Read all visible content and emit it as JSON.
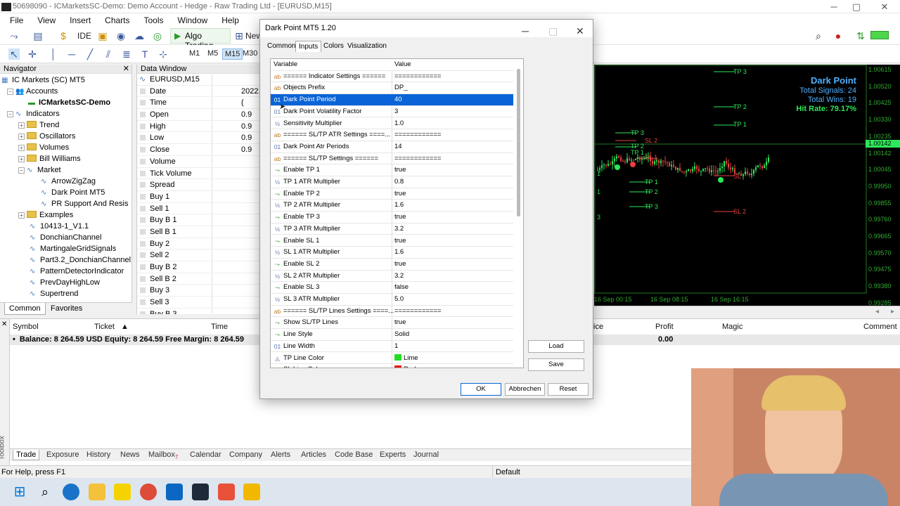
{
  "window": {
    "title": "50698090 - ICMarketsSC-Demo: Demo Account - Hedge - Raw Trading Ltd - [EURUSD,M15]"
  },
  "menu": [
    "File",
    "View",
    "Insert",
    "Charts",
    "Tools",
    "Window",
    "Help"
  ],
  "toolbar": {
    "ide": "IDE",
    "algo_trading": "Algo Trading",
    "new_order": "New",
    "timeframes": [
      "M1",
      "M5",
      "M15",
      "M30"
    ],
    "active_timeframe": "M15"
  },
  "navigator": {
    "title": "Navigator",
    "root": "IC Markets (SC) MT5",
    "accounts": "Accounts",
    "account_name": "ICMarketsSC-Demo",
    "indicators": "Indicators",
    "folders": [
      "Trend",
      "Oscillators",
      "Volumes",
      "Bill Williams"
    ],
    "market": "Market",
    "market_items": [
      "ArrowZigZag",
      "Dark Point MT5",
      "PR Support And Resis"
    ],
    "examples": "Examples",
    "items": [
      "10413-1_V1.1",
      "DonchianChannel",
      "MartingaleGridSignals",
      "Part3.2_DonchianChannel",
      "PatternDetectorIndicator",
      "PrevDayHighLow",
      "Supertrend"
    ],
    "tabs": [
      "Common",
      "Favorites"
    ]
  },
  "data_window": {
    "title": "Data Window",
    "symbol": "EURUSD,M15",
    "rows": [
      {
        "label": "Date",
        "value": "2022."
      },
      {
        "label": "Time",
        "value": "("
      },
      {
        "label": "Open",
        "value": "0.9"
      },
      {
        "label": "High",
        "value": "0.9"
      },
      {
        "label": "Low",
        "value": "0.9"
      },
      {
        "label": "Close",
        "value": "0.9"
      },
      {
        "label": "Volume",
        "value": ""
      },
      {
        "label": "Tick Volume",
        "value": ""
      },
      {
        "label": "Spread",
        "value": ""
      },
      {
        "label": "Buy 1",
        "value": ""
      },
      {
        "label": "Sell 1",
        "value": ""
      },
      {
        "label": "Buy B 1",
        "value": ""
      },
      {
        "label": "Sell B 1",
        "value": ""
      },
      {
        "label": "Buy 2",
        "value": ""
      },
      {
        "label": "Sell 2",
        "value": ""
      },
      {
        "label": "Buy B 2",
        "value": ""
      },
      {
        "label": "Sell B 2",
        "value": ""
      },
      {
        "label": "Buy 3",
        "value": ""
      },
      {
        "label": "Sell 3",
        "value": ""
      },
      {
        "label": "Buy B 3",
        "value": ""
      }
    ]
  },
  "chart": {
    "panel_title": "Dark Point",
    "total_signals": "Total Signals: 24",
    "total_wins": "Total Wins: 19",
    "hit_rate": "Hit Rate: 79.17%",
    "prices": [
      "1.00615",
      "1.00520",
      "1.00425",
      "1.00330",
      "1.00235",
      "1.00142",
      "1.00045",
      "0.99950",
      "0.99855",
      "0.99760",
      "0.99665",
      "0.99570",
      "0.99475",
      "0.99380",
      "0.99285"
    ],
    "current_price": "1.00142",
    "dates": [
      "16 Sep 00:15",
      "16 Sep 08:15",
      "16 Sep 16:15"
    ],
    "labels_tp": [
      "TP 3",
      "TP 2",
      "TP 1",
      "TP 3",
      "TP 2",
      "TP 1",
      "TP 1",
      "TP 2",
      "TP 3"
    ],
    "labels_sl": [
      "SL 2",
      "SL 1",
      "SL",
      "SL 2"
    ],
    "left_digits": [
      "1",
      "1",
      "3"
    ]
  },
  "toolbox": {
    "columns": [
      "Symbol",
      "Ticket",
      "Time",
      "ice",
      "Profit",
      "Magic",
      "Comment"
    ],
    "balance": "Balance: 8 264.59 USD  Equity: 8 264.59  Free Margin: 8 264.59",
    "profit_total": "0.00",
    "side_label": "Toolbox",
    "tabs": [
      "Trade",
      "Exposure",
      "History",
      "News",
      "Mailbox",
      "Calendar",
      "Company",
      "Alerts",
      "Articles",
      "Code Base",
      "Experts",
      "Journal"
    ],
    "mailbox_badge": "7"
  },
  "status": {
    "help": "For Help, press F1",
    "profile": "Default"
  },
  "dialog": {
    "title": "Dark Point MT5 1.20",
    "tabs": [
      "Common",
      "Inputs",
      "Colors",
      "Visualization"
    ],
    "active_tab": "Inputs",
    "header": {
      "variable": "Variable",
      "value": "Value"
    },
    "rows": [
      {
        "type": "ab",
        "name": "====== Indicator Settings ======",
        "value": "============"
      },
      {
        "type": "ab",
        "name": "Objects Prefix",
        "value": "DP_"
      },
      {
        "type": "01",
        "name": "Dark Point Period",
        "value": "40",
        "selected": true
      },
      {
        "type": "01",
        "name": "Dark Point Volatility Factor",
        "value": "3"
      },
      {
        "type": "½",
        "name": "Sensitivity Multiplier",
        "value": "1.0"
      },
      {
        "type": "ab",
        "name": "====== SL/TP ATR Settings ====...",
        "value": "============"
      },
      {
        "type": "01",
        "name": "Dark Point Atr Periods",
        "value": "14"
      },
      {
        "type": "ab",
        "name": "====== SL/TP Settings ======",
        "value": "============"
      },
      {
        "type": "bool",
        "name": "Enable TP 1",
        "value": "true"
      },
      {
        "type": "½",
        "name": "TP 1 ATR Multiplier",
        "value": "0.8"
      },
      {
        "type": "bool",
        "name": "Enable TP 2",
        "value": "true"
      },
      {
        "type": "½",
        "name": "TP 2 ATR Multiplier",
        "value": "1.6"
      },
      {
        "type": "bool",
        "name": "Enable TP 3",
        "value": "true"
      },
      {
        "type": "½",
        "name": "TP 3 ATR Multiplier",
        "value": "3.2"
      },
      {
        "type": "bool",
        "name": "Enable SL 1",
        "value": "true"
      },
      {
        "type": "½",
        "name": "SL 1 ATR Multiplier",
        "value": "1.6"
      },
      {
        "type": "bool",
        "name": "Enable SL 2",
        "value": "true"
      },
      {
        "type": "½",
        "name": "SL 2 ATR Multiplier",
        "value": "3.2"
      },
      {
        "type": "bool",
        "name": "Enable SL 3",
        "value": "false"
      },
      {
        "type": "½",
        "name": "SL 3 ATR Multiplier",
        "value": "5.0"
      },
      {
        "type": "ab",
        "name": "====== SL/TP Lines Settings ====...",
        "value": "============"
      },
      {
        "type": "bool",
        "name": "Show SL/TP Lines",
        "value": "true"
      },
      {
        "type": "enum",
        "name": "Line Style",
        "value": "Solid"
      },
      {
        "type": "01",
        "name": "Line Width",
        "value": "1"
      },
      {
        "type": "color",
        "name": "TP Line Color",
        "value": "Lime",
        "swatch": "#22dd22"
      },
      {
        "type": "color",
        "name": "SL Line Color",
        "value": "Red",
        "swatch": "#ee1111"
      }
    ],
    "buttons": {
      "load": "Load",
      "save": "Save",
      "ok": "OK",
      "cancel": "Abbrechen",
      "reset": "Reset"
    }
  },
  "colors": {
    "selection": "#0a64d8",
    "chart_bg": "#000000",
    "bull": "#2de85a",
    "bear": "#e84040",
    "info": "#4fb0ff"
  }
}
